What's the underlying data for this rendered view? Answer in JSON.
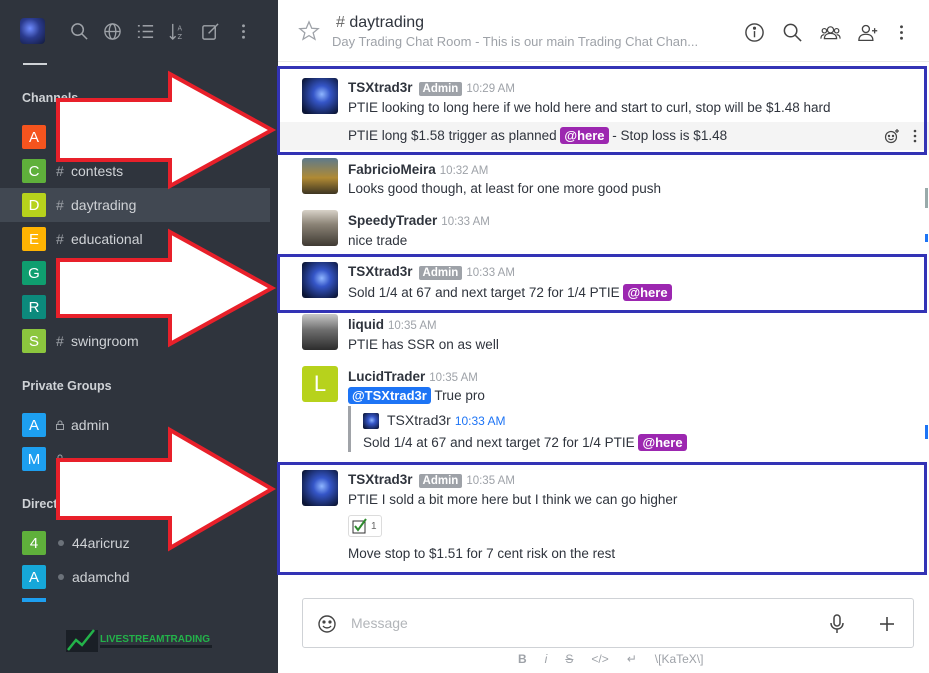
{
  "sidebar": {
    "channels_heading": "Channels",
    "private_heading": "Private Groups",
    "direct_heading": "Direct",
    "channels": [
      {
        "letter": "A",
        "color": "#f5541e",
        "name": ""
      },
      {
        "letter": "C",
        "color": "#5fb03b",
        "name": "contests"
      },
      {
        "letter": "D",
        "color": "#b7d21c",
        "name": "daytrading"
      },
      {
        "letter": "E",
        "color": "#ffb302",
        "name": "educational"
      },
      {
        "letter": "G",
        "color": "#0f9e6f",
        "name": ""
      },
      {
        "letter": "R",
        "color": "#0c8a7c",
        "name": ""
      },
      {
        "letter": "S",
        "color": "#8cc63e",
        "name": "swingroom"
      }
    ],
    "private_groups": [
      {
        "letter": "A",
        "color": "#1d9ff0",
        "name": "admin"
      },
      {
        "letter": "M",
        "color": "#1d9ff0",
        "name": ""
      }
    ],
    "direct": [
      {
        "letter": "4",
        "color": "#5fb03b",
        "name": "44aricruz"
      },
      {
        "letter": "A",
        "color": "#16a7d8",
        "name": "adamchd"
      }
    ],
    "brand": "LIVESTREAMTRADING"
  },
  "room": {
    "name": "daytrading",
    "topic": "Day Trading Chat Room - This is our main Trading Chat Chan..."
  },
  "messages": [
    {
      "user": "TSXtrad3r",
      "role": "Admin",
      "time": "10:29 AM",
      "text": "PTIE looking to long here if we hold here and start to curl, stop will be $1.48 hard",
      "followup_a": "PTIE long $1.58 trigger as planned ",
      "followup_mention": "@here",
      "followup_b": " - Stop loss is $1.48"
    },
    {
      "user": "FabricioMeira",
      "time": "10:32 AM",
      "text": "Looks good though, at least for one more good push"
    },
    {
      "user": "SpeedyTrader",
      "time": "10:33 AM",
      "text": "nice trade"
    },
    {
      "user": "TSXtrad3r",
      "role": "Admin",
      "time": "10:33 AM",
      "text": "Sold 1/4 at 67 and next target 72 for 1/4 PTIE ",
      "mention": "@here"
    },
    {
      "user": "liquid",
      "time": "10:35 AM",
      "text": "PTIE has SSR on as well"
    },
    {
      "user": "LucidTrader",
      "avatar_letter": "L",
      "time": "10:35 AM",
      "mention": "@TSXtrad3r",
      "text": " True pro",
      "quote": {
        "user": "TSXtrad3r",
        "time": "10:33 AM",
        "text": "Sold 1/4 at 67 and next target 72 for 1/4 PTIE ",
        "mention": "@here"
      }
    },
    {
      "user": "TSXtrad3r",
      "role": "Admin",
      "time": "10:35 AM",
      "text": "PTIE I sold a bit more here but I think we can go higher",
      "reaction_count": "1",
      "followup": "Move stop to $1.51 for 7 cent risk on the rest"
    }
  ],
  "composer": {
    "placeholder": "Message"
  },
  "format_bar": [
    "B",
    "i",
    "S",
    "</>",
    "↵",
    "\\[KaTeX\\]"
  ],
  "colors": {
    "highlight": "#3333b5",
    "arrow_fill": "#ffffff",
    "arrow_stroke": "#e8202a",
    "mention": "#9c27b0",
    "user_mention": "#1d74f5"
  }
}
